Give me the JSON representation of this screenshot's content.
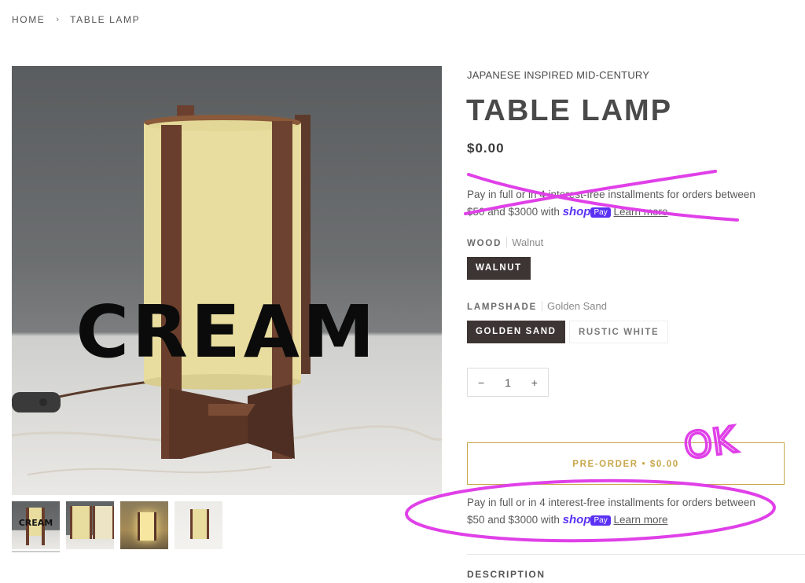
{
  "breadcrumb": {
    "home": "HOME",
    "separator": "›",
    "current": "TABLE LAMP"
  },
  "product": {
    "vendor": "JAPANESE INSPIRED MID-CENTURY",
    "title": "TABLE LAMP",
    "price": "$0.00",
    "image_overlay_text": "CREAM"
  },
  "installments_top": {
    "text": "Pay in full or in 4 interest-free installments for orders between",
    "range": "$50 and $3000 with",
    "shop": "shop",
    "pay": "Pay",
    "learn_more": "Learn more"
  },
  "options": {
    "wood": {
      "label": "WOOD",
      "value": "Walnut",
      "choices": [
        "WALNUT"
      ]
    },
    "lampshade": {
      "label": "LAMPSHADE",
      "value": "Golden Sand",
      "choices": [
        "GOLDEN SAND",
        "RUSTIC WHITE"
      ]
    }
  },
  "quantity": {
    "minus": "−",
    "value": "1",
    "plus": "+"
  },
  "preorder_button": "PRE-ORDER • $0.00",
  "installments_bottom": {
    "text": "Pay in full or in 4 interest-free installments for orders between",
    "range": "$50 and $3000 with",
    "shop": "shop",
    "pay": "Pay",
    "learn_more": "Learn more"
  },
  "annotations": {
    "ok_text": "OK",
    "color": "#e040e8"
  },
  "description_heading": "DESCRIPTION",
  "thumbnail_labels": {
    "first": "CREAM"
  },
  "colors": {
    "accent": "#c9a64a",
    "selected_swatch": "#3d3533",
    "shop_pay": "#5a31f4"
  }
}
